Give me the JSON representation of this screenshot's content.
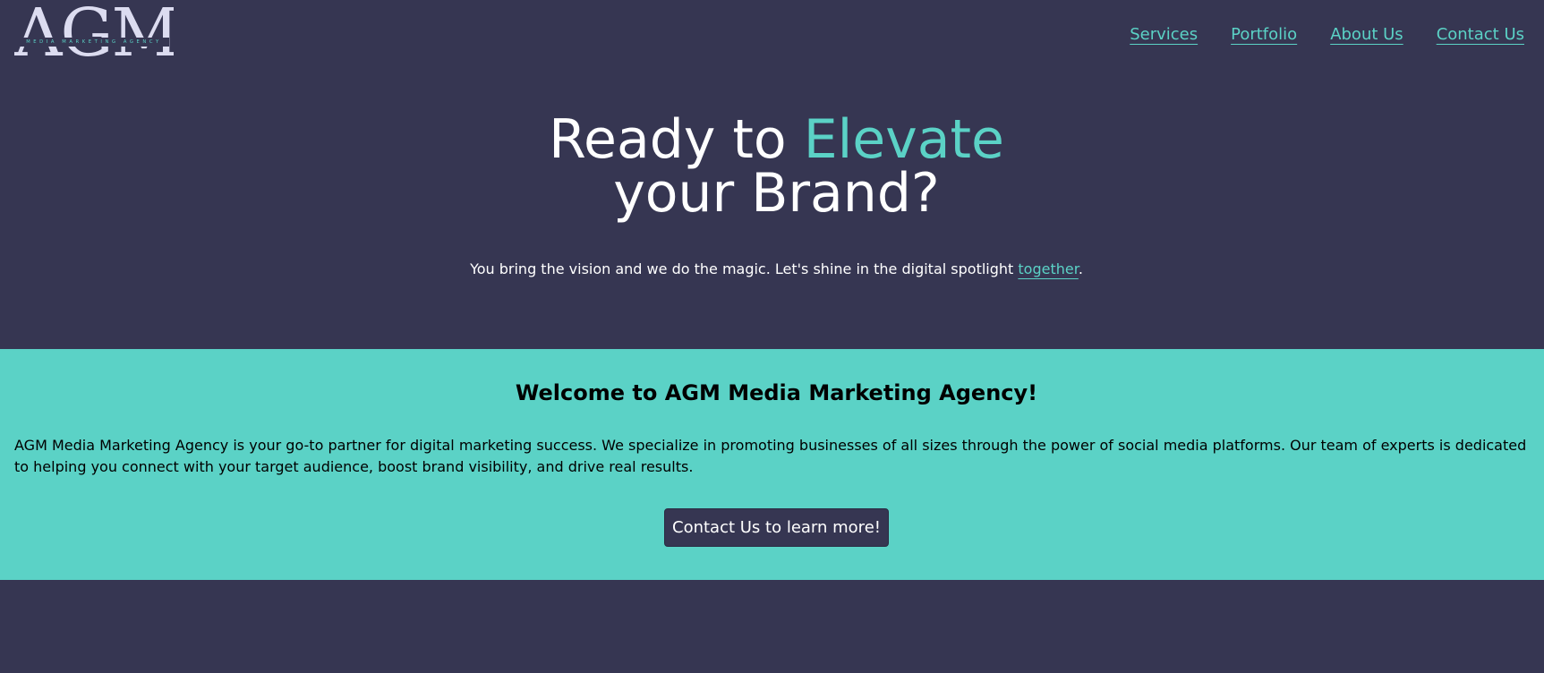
{
  "brand": {
    "logo_text": "AGM",
    "logo_tagline": "MEDIA MARKETING AGENCY"
  },
  "nav": {
    "items": [
      {
        "label": "Services"
      },
      {
        "label": "Portfolio"
      },
      {
        "label": "About Us"
      },
      {
        "label": "Contact Us"
      }
    ]
  },
  "hero": {
    "title_part1": "Ready to ",
    "title_accent": "Elevate",
    "title_part2": "your Brand?",
    "subtitle": "You bring the vision and we do the magic. Let's shine in the digital spotlight ",
    "subtitle_link": "together",
    "subtitle_end": "."
  },
  "welcome": {
    "heading": "Welcome to AGM Media Marketing Agency!",
    "body": "AGM Media Marketing Agency is your go-to partner for digital marketing success. We specialize in promoting businesses of all sizes through the power of social media platforms. Our team of experts is dedicated to helping you connect with your target audience, boost brand visibility, and drive real results.",
    "cta_label": "Contact Us to learn more!"
  },
  "colors": {
    "background": "#363652",
    "accent": "#5bd2c6",
    "text_light": "#ffffff",
    "text_dark": "#000000",
    "logo": "#dcdcf0"
  }
}
